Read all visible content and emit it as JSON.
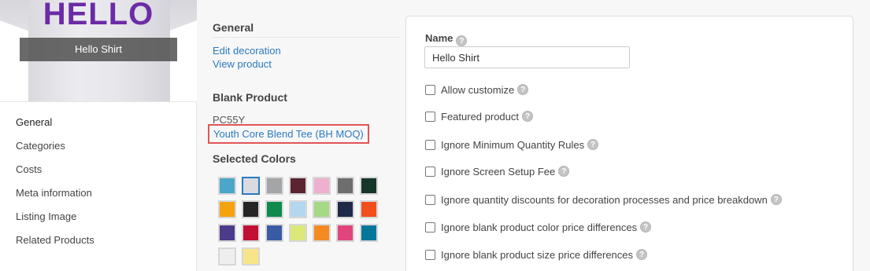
{
  "product_image": {
    "print_text": "HELLO",
    "caption": "Hello Shirt"
  },
  "nav": {
    "items": [
      {
        "label": "General"
      },
      {
        "label": "Categories"
      },
      {
        "label": "Costs"
      },
      {
        "label": "Meta information"
      },
      {
        "label": "Listing Image"
      },
      {
        "label": "Related Products"
      }
    ]
  },
  "middle": {
    "general_title": "General",
    "edit_decoration": "Edit decoration",
    "view_product": "View product",
    "blank_product_title": "Blank Product",
    "blank_sku": "PC55Y",
    "blank_product_link": "Youth Core Blend Tee (BH MOQ)",
    "selected_colors_title": "Selected Colors",
    "colors": [
      "#4aa7c9",
      "#dadbe0",
      "#a3a5a6",
      "#5a2430",
      "#efb0cf",
      "#6e6e6e",
      "#17362a",
      "#f5a20e",
      "#252525",
      "#0e8a4d",
      "#b4d7f0",
      "#a6d986",
      "#1e2a48",
      "#f24f1c",
      "#4c3a8a",
      "#c10f36",
      "#3a5ba3",
      "#dce87a",
      "#f58a22",
      "#e2457e",
      "#04779a",
      "#eeeeee",
      "#f8e58a"
    ],
    "selected_color_index": 1
  },
  "form": {
    "name_label": "Name",
    "name_value": "Hello Shirt",
    "checkboxes": [
      {
        "label": "Allow customize",
        "checked": false
      },
      {
        "label": "Featured product",
        "checked": false
      },
      {
        "label": "Ignore Minimum Quantity Rules",
        "checked": false
      },
      {
        "label": "Ignore Screen Setup Fee",
        "checked": false
      },
      {
        "label": "Ignore quantity discounts for decoration processes and price breakdown",
        "checked": false
      },
      {
        "label": "Ignore blank product color price differences",
        "checked": false
      },
      {
        "label": "Ignore blank product size price differences",
        "checked": false
      }
    ]
  }
}
